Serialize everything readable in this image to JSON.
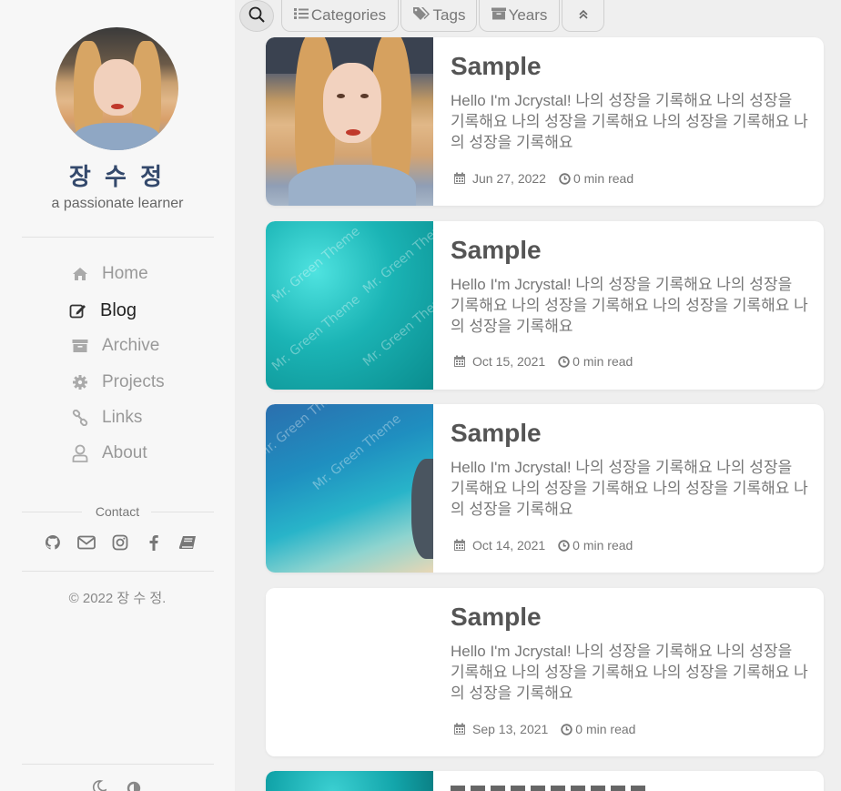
{
  "profile": {
    "name": "장 수 정",
    "tagline": "a passionate learner"
  },
  "nav": {
    "items": [
      {
        "label": "Home",
        "icon": "home-icon"
      },
      {
        "label": "Blog",
        "icon": "edit-icon"
      },
      {
        "label": "Archive",
        "icon": "archive-icon"
      },
      {
        "label": "Projects",
        "icon": "gear-icon"
      },
      {
        "label": "Links",
        "icon": "link-icon"
      },
      {
        "label": "About",
        "icon": "user-icon"
      }
    ],
    "active": "Blog"
  },
  "contact": {
    "label": "Contact",
    "icons": [
      "github-icon",
      "mail-icon",
      "instagram-icon",
      "facebook-icon",
      "book-icon"
    ]
  },
  "footer": {
    "copyright": "© 2022 장 수 정."
  },
  "toolbar": {
    "categories_label": "Categories",
    "tags_label": "Tags",
    "years_label": "Years"
  },
  "posts": [
    {
      "title": "Sample",
      "excerpt": "Hello I'm Jcrystal! 나의 성장을 기록해요 나의 성장을 기록해요 나의 성장을 기록해요 나의 성장을 기록해요 나의 성장을 기록해요",
      "date": "Jun 27, 2022",
      "read": "0 min read"
    },
    {
      "title": "Sample",
      "excerpt": "Hello I'm Jcrystal! 나의 성장을 기록해요 나의 성장을 기록해요 나의 성장을 기록해요 나의 성장을 기록해요 나의 성장을 기록해요",
      "date": "Oct 15, 2021",
      "read": "0 min read"
    },
    {
      "title": "Sample",
      "excerpt": "Hello I'm Jcrystal! 나의 성장을 기록해요 나의 성장을 기록해요 나의 성장을 기록해요 나의 성장을 기록해요 나의 성장을 기록해요",
      "date": "Oct 14, 2021",
      "read": "0 min read"
    },
    {
      "title": "Sample",
      "excerpt": "Hello I'm Jcrystal! 나의 성장을 기록해요 나의 성장을 기록해요 나의 성장을 기록해요 나의 성장을 기록해요 나의 성장을 기록해요",
      "date": "Sep 13, 2021",
      "read": "0 min read"
    }
  ],
  "watermark": "Mr. Green Theme",
  "colors": {
    "name": "#34496c",
    "nav_active": "#222222",
    "nav_inactive": "#999999",
    "sidebar_bg": "#f7f7f7",
    "page_bg": "#efefef"
  }
}
